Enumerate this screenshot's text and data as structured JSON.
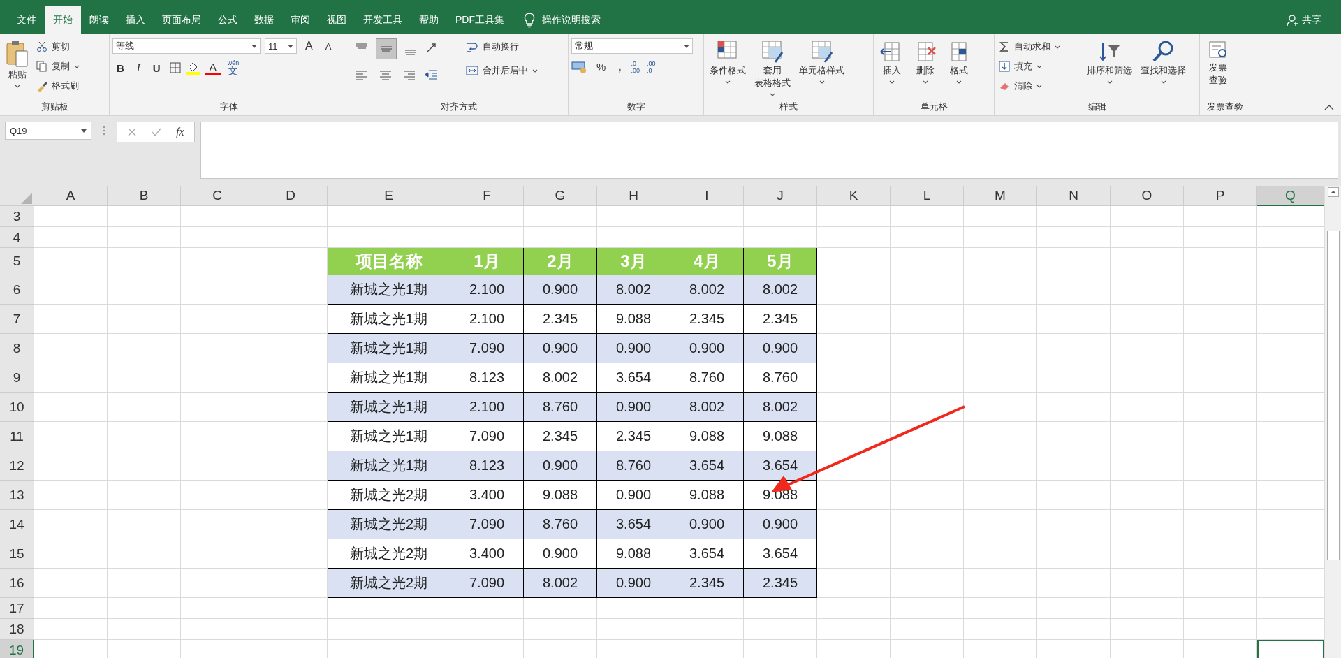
{
  "menu_tabs": [
    {
      "label": "文件",
      "selected": false
    },
    {
      "label": "开始",
      "selected": true
    },
    {
      "label": "朗读",
      "selected": false
    },
    {
      "label": "插入",
      "selected": false
    },
    {
      "label": "页面布局",
      "selected": false
    },
    {
      "label": "公式",
      "selected": false
    },
    {
      "label": "数据",
      "selected": false
    },
    {
      "label": "审阅",
      "selected": false
    },
    {
      "label": "视图",
      "selected": false
    },
    {
      "label": "开发工具",
      "selected": false
    },
    {
      "label": "帮助",
      "selected": false
    },
    {
      "label": "PDF工具集",
      "selected": false
    }
  ],
  "tell_me": "操作说明搜索",
  "share": "共享",
  "ribbon": {
    "clipboard": {
      "label": "剪贴板",
      "paste": "粘贴",
      "items": [
        "剪切",
        "复制",
        "格式刷"
      ]
    },
    "font": {
      "label": "字体",
      "name": "等线",
      "size": "11",
      "grow": "A",
      "shrink": "A",
      "bold": "B",
      "italic": "I",
      "underline": "U",
      "color_letter": "A",
      "phonetic": {
        "top": "wén",
        "bottom": "文"
      }
    },
    "alignment": {
      "label": "对齐方式",
      "vertical": [
        {
          "selected": false
        },
        {
          "selected": true
        },
        {
          "selected": false
        }
      ],
      "wrap": "自动换行",
      "merge": "合并后居中"
    },
    "number": {
      "label": "数字",
      "format": "常规",
      "percent": "%",
      "comma": ",",
      "decimals": [
        {
          "top": ".0",
          "bottom": ".00"
        },
        {
          "top": ".00",
          "bottom": ".0"
        }
      ]
    },
    "styles": {
      "label": "样式",
      "buttons": [
        [
          "条件格式"
        ],
        [
          "套用",
          "表格格式"
        ],
        [
          "单元格样式"
        ]
      ]
    },
    "cells": {
      "label": "单元格",
      "buttons": [
        "插入",
        "删除",
        "格式"
      ]
    },
    "editing": {
      "label": "编辑",
      "small": [
        "自动求和",
        "填充",
        "清除"
      ],
      "big": [
        "排序和筛选",
        "查找和选择"
      ]
    },
    "invoice": {
      "label": "发票查验",
      "button": [
        "发票",
        "查验"
      ]
    }
  },
  "formula_bar": {
    "name_box": "Q19",
    "fx": "fx"
  },
  "sheet": {
    "columns": [
      {
        "letter": "A",
        "selected": false
      },
      {
        "letter": "B",
        "selected": false
      },
      {
        "letter": "C",
        "selected": false
      },
      {
        "letter": "D",
        "selected": false
      },
      {
        "letter": "E",
        "selected": false
      },
      {
        "letter": "F",
        "selected": false
      },
      {
        "letter": "G",
        "selected": false
      },
      {
        "letter": "H",
        "selected": false
      },
      {
        "letter": "I",
        "selected": false
      },
      {
        "letter": "J",
        "selected": false
      },
      {
        "letter": "K",
        "selected": false
      },
      {
        "letter": "L",
        "selected": false
      },
      {
        "letter": "M",
        "selected": false
      },
      {
        "letter": "N",
        "selected": false
      },
      {
        "letter": "O",
        "selected": false
      },
      {
        "letter": "P",
        "selected": false
      },
      {
        "letter": "Q",
        "selected": true
      }
    ],
    "rows": [
      {
        "number": "3",
        "selected": false
      },
      {
        "number": "4",
        "selected": false
      },
      {
        "number": "5",
        "selected": false
      },
      {
        "number": "6",
        "selected": false
      },
      {
        "number": "7",
        "selected": false
      },
      {
        "number": "8",
        "selected": false
      },
      {
        "number": "9",
        "selected": false
      },
      {
        "number": "10",
        "selected": false
      },
      {
        "number": "11",
        "selected": false
      },
      {
        "number": "12",
        "selected": false
      },
      {
        "number": "13",
        "selected": false
      },
      {
        "number": "14",
        "selected": false
      },
      {
        "number": "15",
        "selected": false
      },
      {
        "number": "16",
        "selected": false
      },
      {
        "number": "17",
        "selected": false
      },
      {
        "number": "18",
        "selected": false
      },
      {
        "number": "19",
        "selected": true
      }
    ]
  },
  "table": {
    "header": [
      "项目名称",
      "1月",
      "2月",
      "3月",
      "4月",
      "5月"
    ],
    "rows": [
      [
        "新城之光1期",
        "2.100",
        "0.900",
        "8.002",
        "8.002",
        "8.002"
      ],
      [
        "新城之光1期",
        "2.100",
        "2.345",
        "9.088",
        "2.345",
        "2.345"
      ],
      [
        "新城之光1期",
        "7.090",
        "0.900",
        "0.900",
        "0.900",
        "0.900"
      ],
      [
        "新城之光1期",
        "8.123",
        "8.002",
        "3.654",
        "8.760",
        "8.760"
      ],
      [
        "新城之光1期",
        "2.100",
        "8.760",
        "0.900",
        "8.002",
        "8.002"
      ],
      [
        "新城之光1期",
        "7.090",
        "2.345",
        "2.345",
        "9.088",
        "9.088"
      ],
      [
        "新城之光1期",
        "8.123",
        "0.900",
        "8.760",
        "3.654",
        "3.654"
      ],
      [
        "新城之光2期",
        "3.400",
        "9.088",
        "0.900",
        "9.088",
        "9.088"
      ],
      [
        "新城之光2期",
        "7.090",
        "8.760",
        "3.654",
        "0.900",
        "0.900"
      ],
      [
        "新城之光2期",
        "3.400",
        "0.900",
        "9.088",
        "3.654",
        "3.654"
      ],
      [
        "新城之光2期",
        "7.090",
        "8.002",
        "0.900",
        "2.345",
        "2.345"
      ]
    ]
  }
}
